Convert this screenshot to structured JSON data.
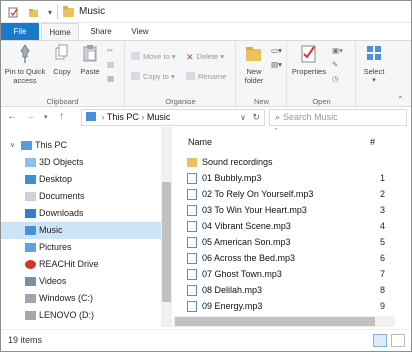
{
  "window": {
    "title": "Music"
  },
  "quick_access": {
    "icons": [
      "properties-icon",
      "new-folder-icon",
      "customize-dropdown-icon"
    ]
  },
  "ribbon": {
    "tabs": [
      "File",
      "Home",
      "Share",
      "View"
    ],
    "active_tab": "Home",
    "groups": {
      "clipboard": {
        "label": "Clipboard",
        "pin": "Pin to Quick access",
        "copy": "Copy",
        "paste": "Paste"
      },
      "organise": {
        "label": "Organise",
        "move_to": "Move to",
        "copy_to": "Copy to",
        "delete": "Delete",
        "rename": "Rename"
      },
      "new": {
        "label": "New",
        "new_folder": "New folder"
      },
      "open": {
        "label": "Open",
        "properties": "Properties"
      },
      "select": {
        "label": "Select"
      }
    }
  },
  "address": {
    "path": [
      "This PC",
      "Music"
    ],
    "search_placeholder": "Search Music"
  },
  "nav_pane": {
    "items": [
      {
        "label": "This PC",
        "icon": "pc-icon"
      },
      {
        "label": "3D Objects",
        "icon": "3d-objects-icon"
      },
      {
        "label": "Desktop",
        "icon": "desktop-icon"
      },
      {
        "label": "Documents",
        "icon": "documents-icon"
      },
      {
        "label": "Downloads",
        "icon": "downloads-icon"
      },
      {
        "label": "Music",
        "icon": "music-icon",
        "selected": true
      },
      {
        "label": "Pictures",
        "icon": "pictures-icon"
      },
      {
        "label": "REACHit Drive",
        "icon": "reachit-icon"
      },
      {
        "label": "Videos",
        "icon": "videos-icon"
      },
      {
        "label": "Windows (C:)",
        "icon": "drive-icon"
      },
      {
        "label": "LENOVO (D:)",
        "icon": "drive-icon"
      }
    ]
  },
  "file_list": {
    "columns": {
      "name": "Name",
      "number": "#"
    },
    "items": [
      {
        "name": "Sound recordings",
        "number": "",
        "type": "folder"
      },
      {
        "name": "01 Bubbly.mp3",
        "number": "1",
        "type": "mp3"
      },
      {
        "name": "02 To Rely On Yourself.mp3",
        "number": "2",
        "type": "mp3"
      },
      {
        "name": "03 To Win Your Heart.mp3",
        "number": "3",
        "type": "mp3"
      },
      {
        "name": "04 Vibrant Scene.mp3",
        "number": "4",
        "type": "mp3"
      },
      {
        "name": "05 American Son.mp3",
        "number": "5",
        "type": "mp3"
      },
      {
        "name": "06 Across the Bed.mp3",
        "number": "6",
        "type": "mp3"
      },
      {
        "name": "07 Ghost Town.mp3",
        "number": "7",
        "type": "mp3"
      },
      {
        "name": "08 Delilah.mp3",
        "number": "8",
        "type": "mp3"
      },
      {
        "name": "09 Energy.mp3",
        "number": "9",
        "type": "mp3"
      }
    ]
  },
  "status_bar": {
    "item_count": "19 items"
  },
  "colors": {
    "accent": "#1979ca",
    "selection": "#cce4f7",
    "folder": "#e8c25c"
  }
}
